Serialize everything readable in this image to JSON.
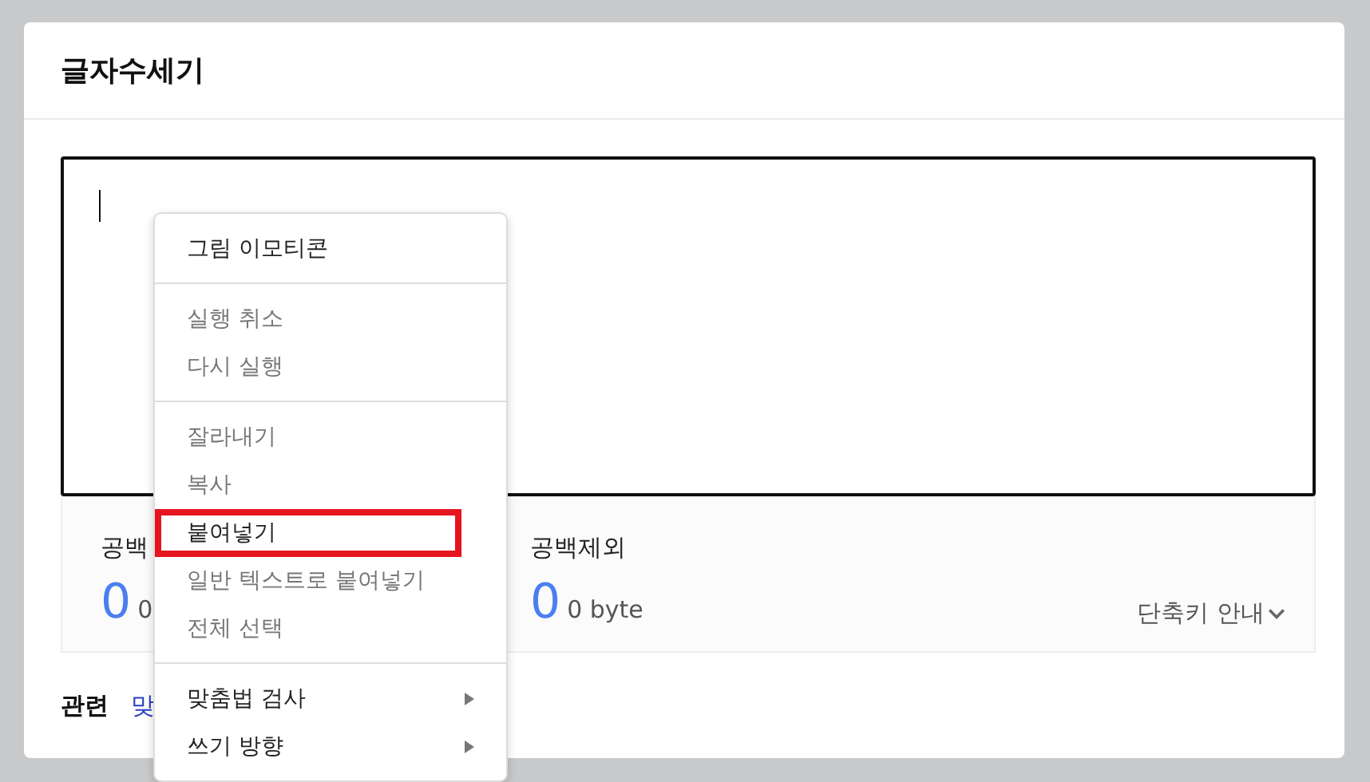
{
  "card": {
    "title": "글자수세기"
  },
  "editor": {
    "caret": true
  },
  "stats": [
    {
      "label": "공백",
      "count": "0",
      "bytes": "0"
    },
    {
      "label": "공백제외",
      "count": "0",
      "bytes": "0 byte"
    }
  ],
  "shortcut_link": "단축키 안내",
  "related": {
    "label": "관련",
    "links": [
      "맞"
    ]
  },
  "context_menu": {
    "groups": [
      [
        {
          "label": "그림 이모티콘",
          "disabled": false,
          "submenu": false,
          "highlighted": false
        }
      ],
      [
        {
          "label": "실행 취소",
          "disabled": true,
          "submenu": false,
          "highlighted": false
        },
        {
          "label": "다시 실행",
          "disabled": true,
          "submenu": false,
          "highlighted": false
        }
      ],
      [
        {
          "label": "잘라내기",
          "disabled": true,
          "submenu": false,
          "highlighted": false
        },
        {
          "label": "복사",
          "disabled": true,
          "submenu": false,
          "highlighted": false
        },
        {
          "label": "붙여넣기",
          "disabled": false,
          "submenu": false,
          "highlighted": true
        },
        {
          "label": "일반 텍스트로 붙여넣기",
          "disabled": true,
          "submenu": false,
          "highlighted": false
        },
        {
          "label": "전체 선택",
          "disabled": true,
          "submenu": false,
          "highlighted": false
        }
      ],
      [
        {
          "label": "맞춤법 검사",
          "disabled": false,
          "submenu": true,
          "highlighted": false
        },
        {
          "label": "쓰기 방향",
          "disabled": false,
          "submenu": true,
          "highlighted": false
        }
      ]
    ]
  }
}
